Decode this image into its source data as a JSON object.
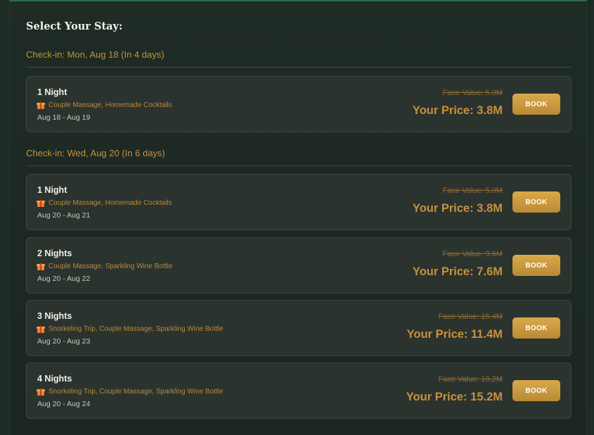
{
  "title": "Select Your Stay:",
  "groups": [
    {
      "header": "Check-in: Mon, Aug 18 (In 4 days)",
      "options": [
        {
          "nights": "1 Night",
          "perks": "Couple Massage, Homemade Cocktails",
          "dates": "Aug 18 - Aug 19",
          "face": "Face Value: 5.0M",
          "price": "Your Price: 3.8M",
          "button": "BOOK"
        }
      ]
    },
    {
      "header": "Check-in: Wed, Aug 20 (In 6 days)",
      "options": [
        {
          "nights": "1 Night",
          "perks": "Couple Massage, Homemade Cocktails",
          "dates": "Aug 20 - Aug 21",
          "face": "Face Value: 5.0M",
          "price": "Your Price: 3.8M",
          "button": "BOOK"
        },
        {
          "nights": "2 Nights",
          "perks": "Couple Massage, Sparkling Wine Bottle",
          "dates": "Aug 20 - Aug 22",
          "face": "Face Value: 9.6M",
          "price": "Your Price: 7.6M",
          "button": "BOOK"
        },
        {
          "nights": "3 Nights",
          "perks": "Snorkeling Trip, Couple Massage, Sparkling Wine Bottle",
          "dates": "Aug 20 - Aug 23",
          "face": "Face Value: 15.4M",
          "price": "Your Price: 11.4M",
          "button": "BOOK"
        },
        {
          "nights": "4 Nights",
          "perks": "Snorkeling Trip, Couple Massage, Sparkling Wine Bottle",
          "dates": "Aug 20 - Aug 24",
          "face": "Face Value: 19.2M",
          "price": "Your Price: 15.2M",
          "button": "BOOK"
        }
      ]
    }
  ],
  "icons": {
    "perk": "gift-icon"
  },
  "colors": {
    "accent": "#c8913a",
    "button": "#c9993e",
    "background": "#1f2b25",
    "card": "#2b332f"
  }
}
